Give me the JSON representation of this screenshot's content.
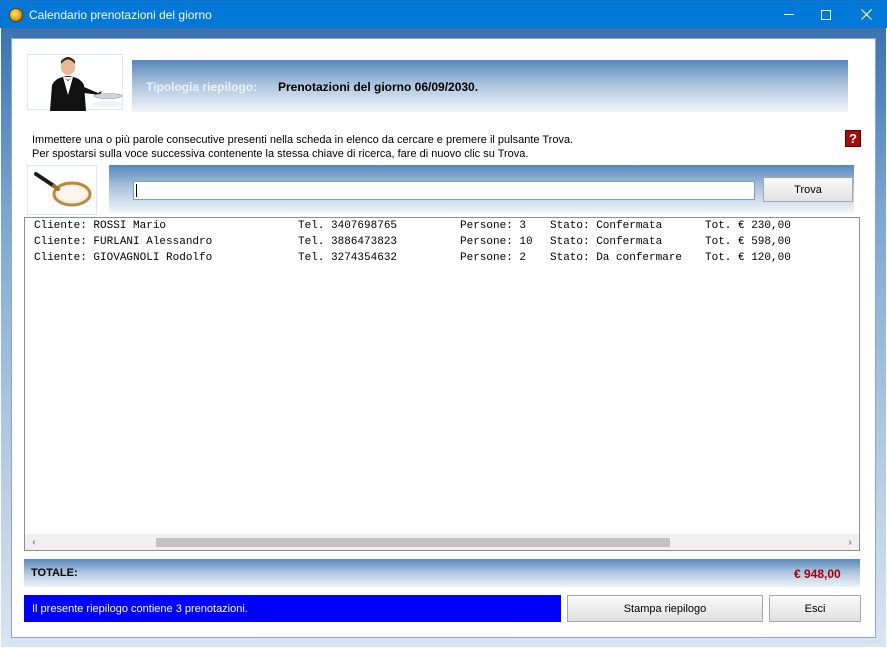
{
  "window": {
    "title": "Calendario prenotazioni del giorno",
    "minimize_icon": "minimize-icon",
    "maximize_icon": "maximize-icon",
    "close_icon": "close-icon"
  },
  "header": {
    "type_label": "Tipologia riepilogo:",
    "type_value": "Prenotazioni del giorno 06/09/2030."
  },
  "instructions": {
    "line1": "Immettere una o più parole consecutive presenti nella scheda in elenco da cercare e premere il pulsante Trova.",
    "line2": "Per spostarsi sulla voce successiva contenente la stessa chiave di ricerca, fare di nuovo clic su Trova.",
    "help_label": "?"
  },
  "search": {
    "value": "",
    "placeholder": "",
    "button_label": "Trova"
  },
  "list": {
    "rows": [
      {
        "cliente": "Cliente: ROSSI Mario",
        "tel": "Tel. 3407698765",
        "persone": "Persone: 3",
        "stato": "Stato: Confermata",
        "tot": "Tot. € 230,00"
      },
      {
        "cliente": "Cliente: FURLANI Alessandro",
        "tel": "Tel. 3886473823",
        "persone": "Persone: 10",
        "stato": "Stato: Confermata",
        "tot": "Tot. € 598,00"
      },
      {
        "cliente": "Cliente: GIOVAGNOLI Rodolfo",
        "tel": "Tel. 3274354632",
        "persone": "Persone: 2",
        "stato": "Stato: Da confermare",
        "tot": "Tot. € 120,00"
      }
    ],
    "scroll_left": "‹",
    "scroll_right": "›"
  },
  "totals": {
    "label": "TOTALE:",
    "value": "€ 948,00"
  },
  "footer": {
    "status": "Il presente riepilogo contiene 3 prenotazioni.",
    "print_label": "Stampa riepilogo",
    "exit_label": "Esci"
  },
  "colors": {
    "titlebar": "#0078d7",
    "status_bar": "#0000ff",
    "total_value": "#a40000"
  }
}
